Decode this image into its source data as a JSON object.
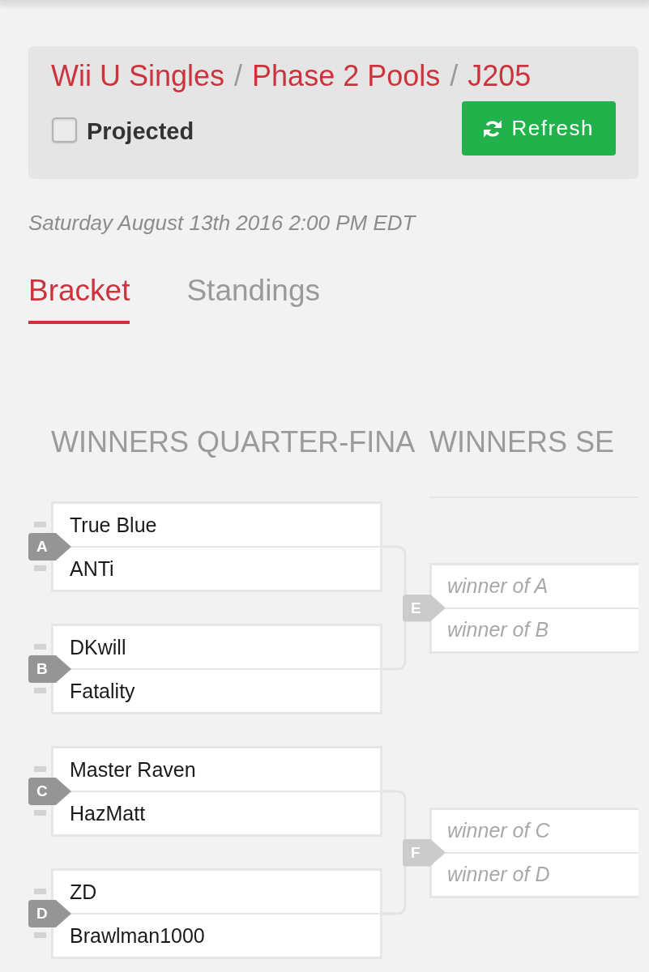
{
  "breadcrumb": [
    {
      "kind": "link",
      "text": "Wii U Singles"
    },
    {
      "kind": "separator",
      "text": "/"
    },
    {
      "kind": "link",
      "text": "Phase 2 Pools"
    },
    {
      "kind": "separator",
      "text": "/"
    },
    {
      "kind": "link",
      "text": "J205"
    }
  ],
  "projected": {
    "label": "Projected",
    "checked": false
  },
  "refresh_button": {
    "label": "Refresh"
  },
  "date": "Saturday August 13th 2016 2:00 PM EDT",
  "tabs": [
    {
      "label": "Bracket",
      "selected": true
    },
    {
      "label": "Standings",
      "selected": false
    }
  ],
  "bracket": {
    "rounds": [
      {
        "title": "WINNERS QUARTER-FINA",
        "matches": [
          {
            "id": "A",
            "pending": false,
            "slots": [
              {
                "kind": "player",
                "name": "True Blue"
              },
              {
                "kind": "player",
                "name": "ANTi"
              }
            ]
          },
          {
            "id": "B",
            "pending": false,
            "slots": [
              {
                "kind": "player",
                "name": "DKwill"
              },
              {
                "kind": "player",
                "name": "Fatality"
              }
            ]
          },
          {
            "id": "C",
            "pending": false,
            "slots": [
              {
                "kind": "player",
                "name": "Master Raven"
              },
              {
                "kind": "player",
                "name": "HazMatt"
              }
            ]
          },
          {
            "id": "D",
            "pending": false,
            "slots": [
              {
                "kind": "player",
                "name": "ZD"
              },
              {
                "kind": "player",
                "name": "Brawlman1000"
              }
            ]
          }
        ]
      },
      {
        "title": "WINNERS SE",
        "matches": [
          {
            "id": "E",
            "pending": true,
            "slots": [
              {
                "kind": "placeholder",
                "name": "winner of A"
              },
              {
                "kind": "placeholder",
                "name": "winner of B"
              }
            ]
          },
          {
            "id": "F",
            "pending": true,
            "slots": [
              {
                "kind": "placeholder",
                "name": "winner of C"
              },
              {
                "kind": "placeholder",
                "name": "winner of D"
              }
            ]
          }
        ]
      }
    ]
  }
}
